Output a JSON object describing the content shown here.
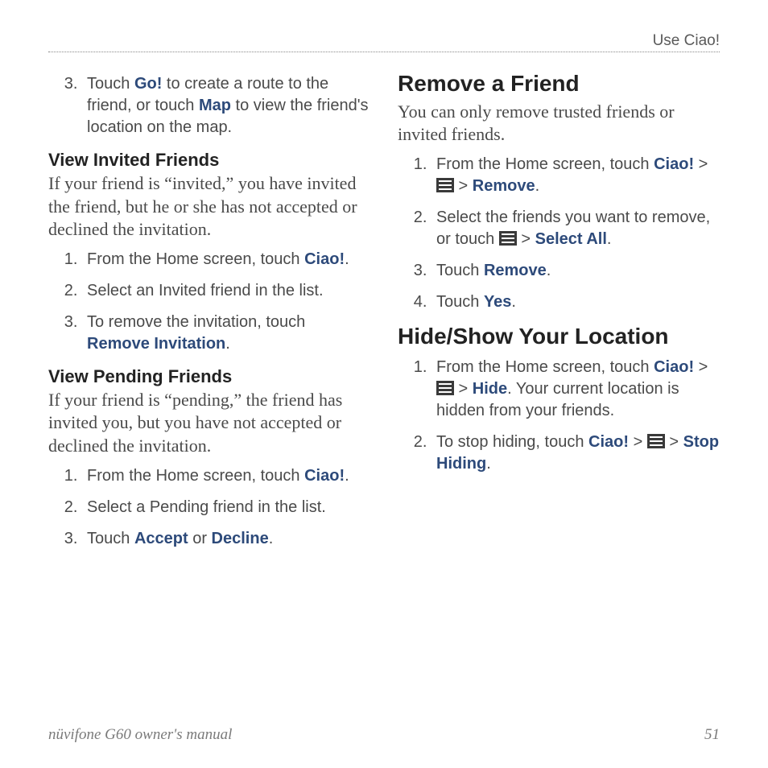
{
  "header": {
    "right": "Use Ciao!"
  },
  "footer": {
    "left": "nüvifone G60 owner's manual",
    "right": "51"
  },
  "kw": {
    "go": "Go!",
    "map": "Map",
    "ciao": "Ciao!",
    "remove_invitation": "Remove Invitation",
    "accept": "Accept",
    "decline": "Decline",
    "remove": "Remove",
    "select_all": "Select All",
    "yes": "Yes",
    "hide": "Hide",
    "stop_hiding": "Stop Hiding"
  },
  "left": {
    "step3": {
      "num": "3.",
      "t1": "Touch ",
      "t2": " to create a route to the friend, or touch ",
      "t3": " to view the friend's location on the map."
    },
    "invited": {
      "heading": "View Invited Friends",
      "body": "If your friend is “invited,” you have invited the friend, but he or she has not accepted or declined the invitation.",
      "s1a": "From the Home screen, touch ",
      "s1b": ".",
      "s2": "Select an Invited friend in the list.",
      "s3a": "To remove the invitation, touch ",
      "s3b": "."
    },
    "pending": {
      "heading": "View Pending Friends",
      "body": "If your friend is “pending,” the friend has invited you, but you have not accepted or declined the invitation.",
      "s1a": "From the Home screen, touch ",
      "s1b": ".",
      "s2": "Select a Pending friend in the list.",
      "s3a": "Touch ",
      "s3b": " or ",
      "s3c": "."
    }
  },
  "right": {
    "remove": {
      "heading": "Remove a Friend",
      "body": "You can only remove trusted friends or invited friends.",
      "s1a": "From the Home screen, touch ",
      "s1b": " > ",
      "s1c": " > ",
      "s1d": ".",
      "s2a": "Select the friends you want to remove, or touch ",
      "s2b": " > ",
      "s2c": ".",
      "s3a": "Touch ",
      "s3b": ".",
      "s4a": "Touch ",
      "s4b": "."
    },
    "hide": {
      "heading": "Hide/Show Your Location",
      "s1a": "From the Home screen, touch ",
      "s1b": " > ",
      "s1c": " > ",
      "s1d": ". Your current location is hidden from your friends.",
      "s2a": "To stop hiding, touch ",
      "s2b": " > ",
      "s2c": " > ",
      "s2d": "."
    }
  }
}
